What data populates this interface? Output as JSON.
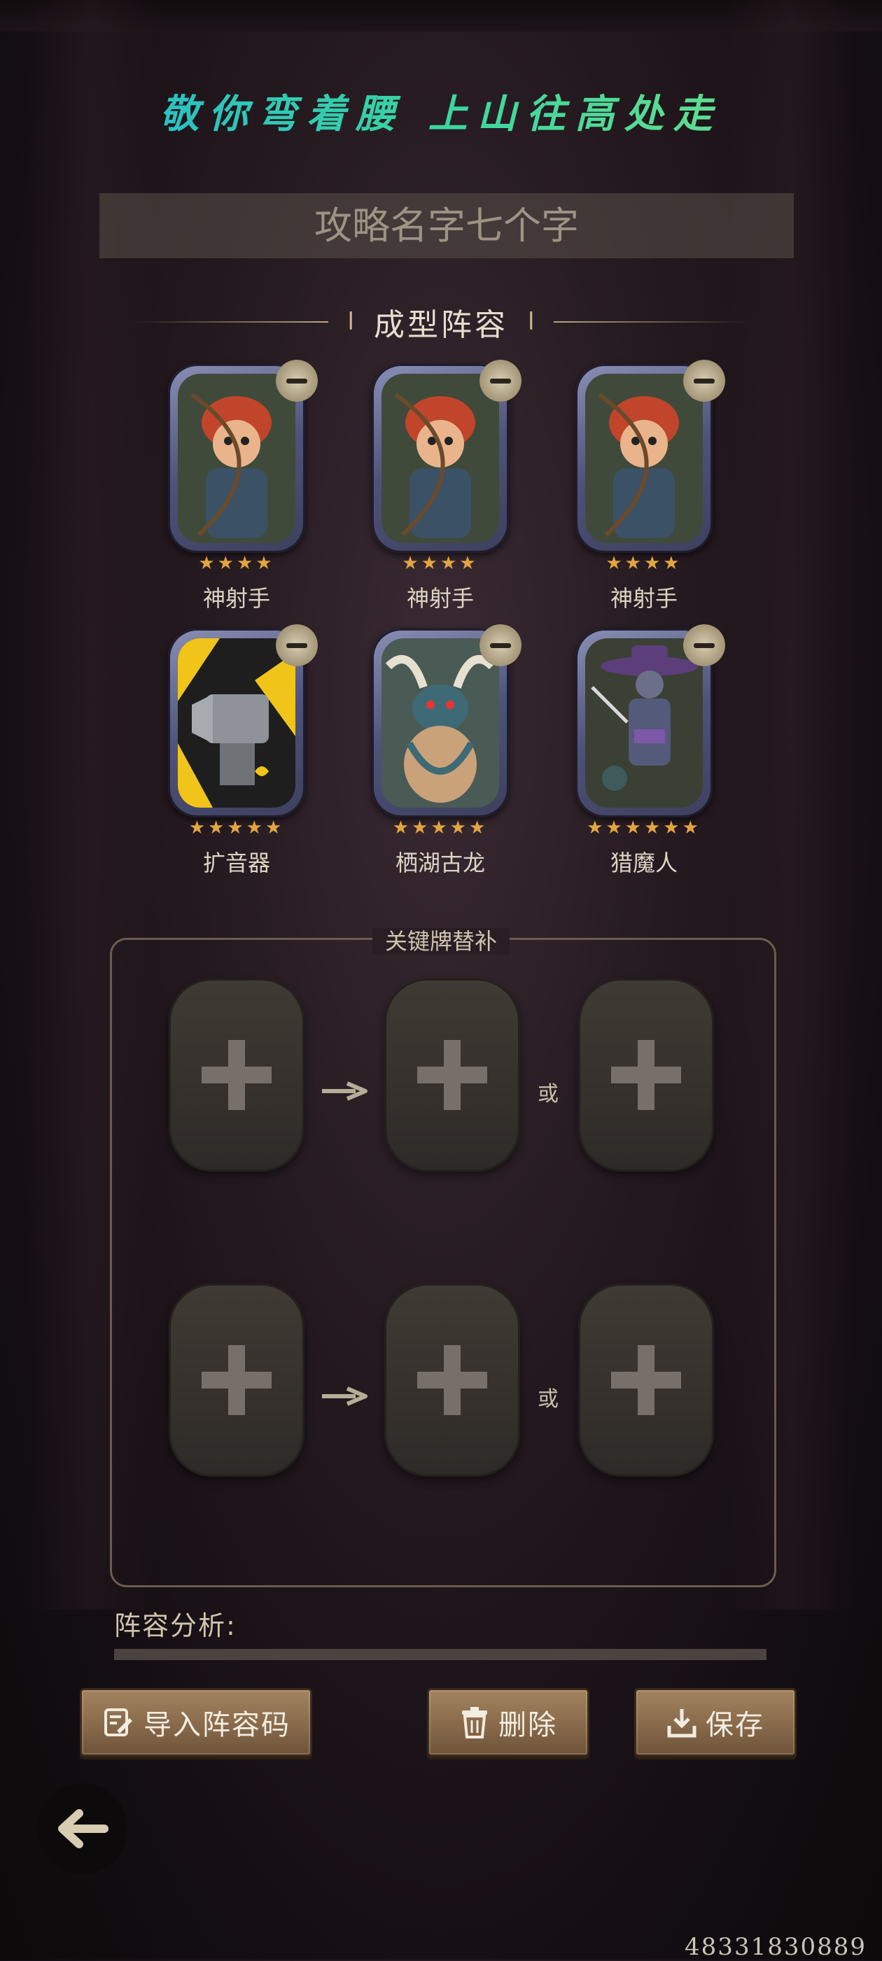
{
  "header": {
    "motto": "敬你弯着腰 上山往高处走"
  },
  "strategy_name": {
    "placeholder": "攻略名字七个字"
  },
  "lineup": {
    "title": "成型阵容",
    "cards": [
      {
        "name": "神射手",
        "stars": 4,
        "art": "archer-art"
      },
      {
        "name": "神射手",
        "stars": 4,
        "art": "archer-art"
      },
      {
        "name": "神射手",
        "stars": 4,
        "art": "archer-art"
      },
      {
        "name": "扩音器",
        "stars": 5,
        "art": "loudspeaker-robot-art"
      },
      {
        "name": "栖湖古龙",
        "stars": 5,
        "art": "lake-dragon-art"
      },
      {
        "name": "猎魔人",
        "stars": 6,
        "art": "demon-hunter-art"
      }
    ]
  },
  "substitutes": {
    "title": "关键牌替补",
    "or_label_1": "或",
    "or_label_2": "或"
  },
  "analysis": {
    "label": "阵容分析:"
  },
  "buttons": {
    "import_code": "导入阵容码",
    "delete": "删除",
    "save": "保存"
  },
  "watermark": "48331830889",
  "colors": {
    "star": "#e3a53f",
    "wood": "#8a6c4d",
    "frame": "#5a5e86"
  }
}
